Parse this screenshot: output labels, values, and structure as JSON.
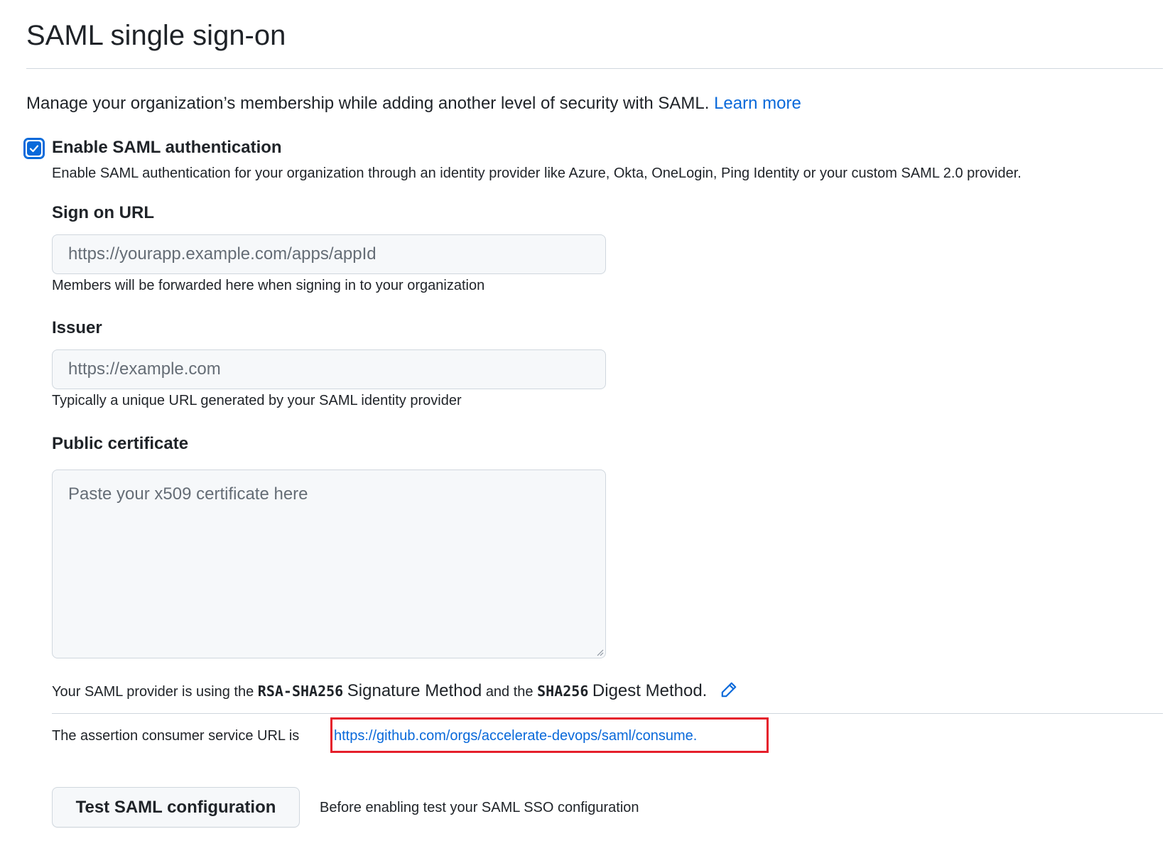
{
  "page": {
    "title": "SAML single sign-on"
  },
  "intro": {
    "text": "Manage your organization’s membership while adding another level of security with SAML.",
    "learn_more": "Learn more"
  },
  "enable": {
    "checked": true,
    "label": "Enable SAML authentication",
    "description": "Enable SAML authentication for your organization through an identity provider like Azure, Okta, OneLogin, Ping Identity or your custom SAML 2.0 provider."
  },
  "sign_on_url": {
    "label": "Sign on URL",
    "placeholder": "https://yourapp.example.com/apps/appId",
    "value": "",
    "help": "Members will be forwarded here when signing in to your organization"
  },
  "issuer": {
    "label": "Issuer",
    "placeholder": "https://example.com",
    "value": "",
    "help": "Typically a unique URL generated by your SAML identity provider"
  },
  "certificate": {
    "label": "Public certificate",
    "placeholder": "Paste your x509 certificate here",
    "value": ""
  },
  "methods": {
    "prefix": "Your SAML provider is using the",
    "signature_method": "RSA-SHA256",
    "signature_label": "Signature Method",
    "and_the": "and the",
    "digest_method": "SHA256",
    "digest_label": "Digest Method.",
    "edit_icon": "pencil-icon"
  },
  "acs": {
    "prefix": "The assertion consumer service URL is",
    "url": "https://github.com/orgs/accelerate-devops/saml/consume.",
    "highlight_color": "#e5202c"
  },
  "test": {
    "button_label": "Test SAML configuration",
    "note": "Before enabling test your SAML SSO configuration"
  },
  "colors": {
    "link": "#0969da",
    "text": "#1f2328",
    "border": "#d0d7de",
    "input_bg": "#f6f8fa"
  }
}
